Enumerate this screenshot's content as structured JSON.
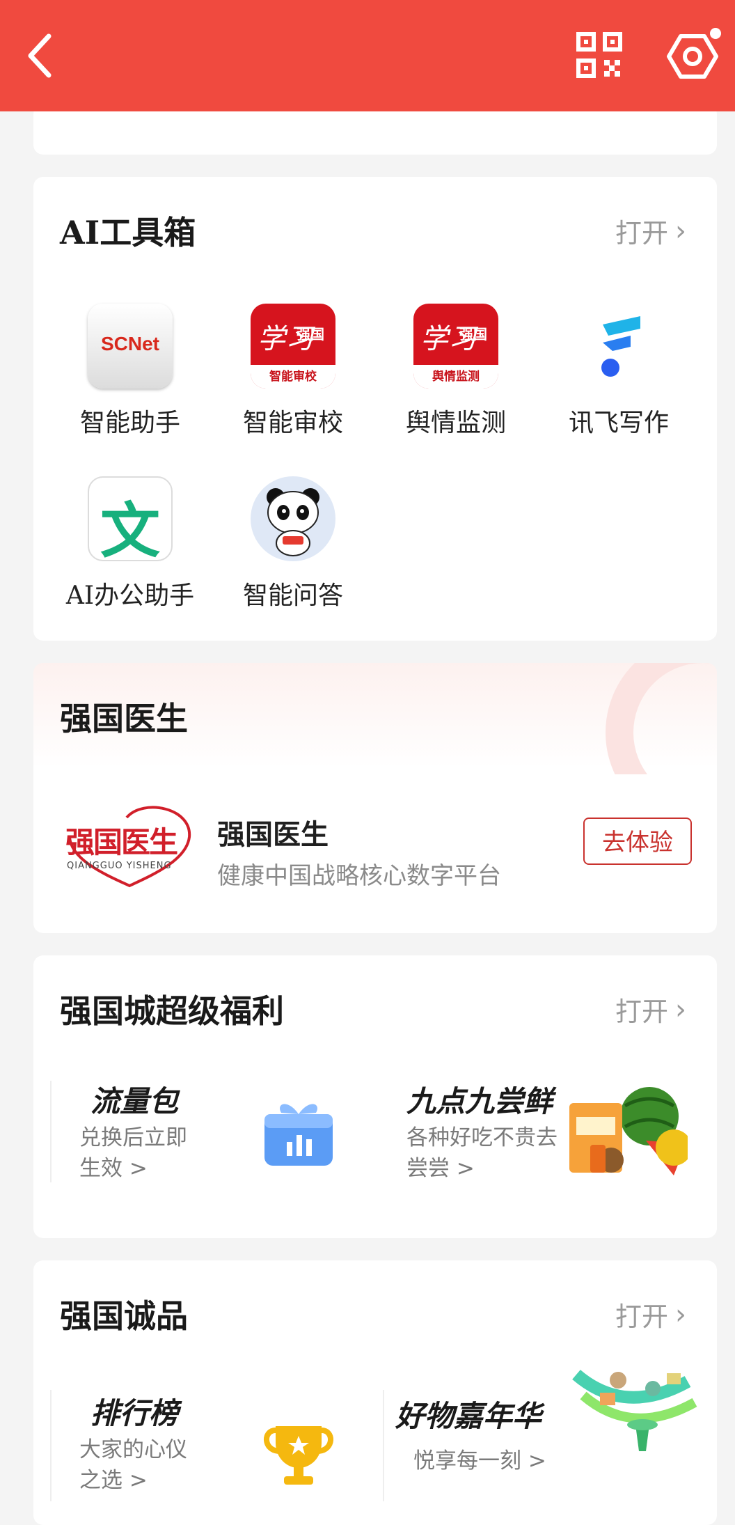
{
  "header": {
    "bg_color": "#f04a3f",
    "back_icon": "chevron-left-icon",
    "qr_icon": "qr-code-icon",
    "settings_icon": "settings-icon"
  },
  "ai_toolbox": {
    "title": "AI工具箱",
    "open_label": "打开",
    "tools": [
      {
        "label": "智能助手",
        "icon": "scnet-icon",
        "icon_text": "SCNet"
      },
      {
        "label": "智能审校",
        "icon": "xuexi-review-icon",
        "icon_text": "智能审校"
      },
      {
        "label": "舆情监测",
        "icon": "xuexi-monitor-icon",
        "icon_text": "舆情监测"
      },
      {
        "label": "讯飞写作",
        "icon": "xunfei-icon"
      },
      {
        "label": "AI办公助手",
        "icon": "wen-icon",
        "icon_text": "文"
      },
      {
        "label": "智能问答",
        "icon": "panda-icon"
      }
    ]
  },
  "doctor": {
    "title": "强国医生",
    "app_name": "强国医生",
    "app_desc": "健康中国战略核心数字平台",
    "logo_text": "强国医生",
    "logo_sub": "QIANGGUO YISHENG",
    "button_label": "去体验"
  },
  "mall": {
    "title": "强国城超级福利",
    "open_label": "打开",
    "items": [
      {
        "title": "流量包",
        "subtitle": "兑换后立即生效 >",
        "icon": "gift-box-icon"
      },
      {
        "title": "九点九尝鲜",
        "subtitle": "各种好吃不贵去尝尝 >",
        "icon": "fruit-image"
      }
    ]
  },
  "chengpin": {
    "title": "强国诚品",
    "open_label": "打开",
    "items": [
      {
        "title": "排行榜",
        "subtitle": "大家的心仪之选 >",
        "icon": "trophy-icon"
      },
      {
        "title": "好物嘉年华",
        "subtitle": "悦享每一刻 >",
        "icon": "carnival-image"
      }
    ]
  }
}
